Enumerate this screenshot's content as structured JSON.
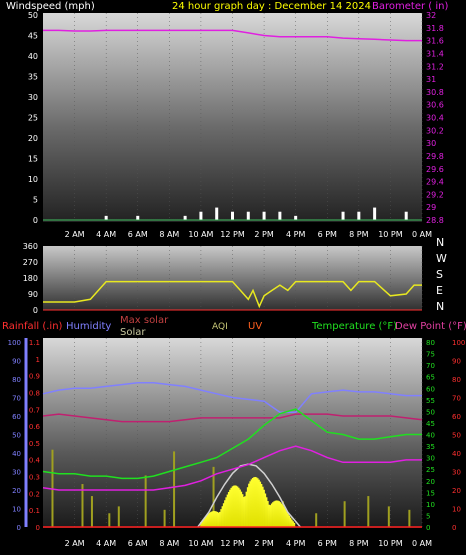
{
  "header": {
    "left_label": "Windspeed (mph)",
    "title": "24 hour graph day : December 14 2024",
    "right_label": "Barometer ( in)"
  },
  "colors": {
    "windspeed": "#ffffff",
    "barometer": "#e020e0",
    "direction": "#e8e820",
    "rainfall": "#ff3030",
    "humidity": "#8080ff",
    "solar": "#ffff00",
    "max_solar": "#c8c8c8",
    "uv": "#ff6020",
    "aqi": "#c8c878",
    "temperature": "#20e020",
    "dew_point": "#c02070",
    "temp_red": "#ff2020"
  },
  "x_ticks": [
    "2 AM",
    "4 AM",
    "6 AM",
    "8 AM",
    "10 AM",
    "12 PM",
    "2 PM",
    "4 PM",
    "6 PM",
    "8 PM",
    "10 PM",
    "0 AM"
  ],
  "panel1": {
    "left_ticks": [
      "0",
      "5",
      "10",
      "15",
      "20",
      "25",
      "30",
      "35",
      "40",
      "45",
      "50"
    ],
    "right_ticks": [
      "28.8",
      "29",
      "29.2",
      "29.4",
      "29.6",
      "29.8",
      "30",
      "30.2",
      "30.4",
      "30.6",
      "30.8",
      "31",
      "31.2",
      "31.4",
      "31.6",
      "31.8",
      "32"
    ]
  },
  "panel2": {
    "left_ticks": [
      "0",
      "90",
      "180",
      "270",
      "360"
    ],
    "compass": [
      "N",
      "W",
      "S",
      "E",
      "N"
    ]
  },
  "panel3": {
    "legend": {
      "rainfall": "Rainfall (.in)",
      "humidity": "Humidity",
      "max_solar": "Max solar",
      "solar": "Solar",
      "aqi": "AQI",
      "uv": "UV",
      "temperature": "Temperature (°F)",
      "dew_point": "Dew Point (°F)"
    },
    "left_outer_ticks": [
      "0",
      "10",
      "20",
      "30",
      "40",
      "50",
      "60",
      "70",
      "80",
      "90",
      "100"
    ],
    "left_inner_ticks": [
      "0",
      "0.1",
      "0.2",
      "0.3",
      "0.4",
      "0.5",
      "0.6",
      "0.7",
      "0.8",
      "0.9",
      "1",
      "1.1"
    ],
    "right_green_ticks": [
      "0",
      "5",
      "10",
      "15",
      "20",
      "25",
      "30",
      "35",
      "40",
      "45",
      "50",
      "55",
      "60",
      "65",
      "70",
      "75",
      "80"
    ],
    "right_red_ticks": [
      "0",
      "10",
      "20",
      "30",
      "40",
      "50",
      "60",
      "70",
      "80",
      "90",
      "100"
    ]
  },
  "chart_data": [
    {
      "type": "line",
      "title": "24 hour graph day : December 14 2024",
      "x_hours": [
        0,
        1,
        2,
        3,
        4,
        5,
        6,
        7,
        8,
        9,
        10,
        11,
        12,
        13,
        14,
        15,
        16,
        17,
        18,
        19,
        20,
        21,
        22,
        23,
        24
      ],
      "series": [
        {
          "name": "Barometer ( in)",
          "axis": "right",
          "ylim": [
            28.8,
            32.0
          ],
          "values": [
            31.76,
            31.76,
            31.75,
            31.75,
            31.76,
            31.76,
            31.76,
            31.76,
            31.76,
            31.76,
            31.76,
            31.76,
            31.76,
            31.72,
            31.68,
            31.66,
            31.66,
            31.66,
            31.66,
            31.64,
            31.63,
            31.62,
            31.61,
            31.6,
            31.6
          ]
        },
        {
          "name": "Windspeed (mph)",
          "axis": "left",
          "ylim": [
            0,
            50
          ],
          "values": [
            0,
            0,
            0,
            0,
            1,
            0,
            1,
            0,
            0,
            1,
            2,
            3,
            2,
            2,
            2,
            2,
            1,
            0,
            0,
            2,
            2,
            3,
            0,
            2,
            0
          ]
        }
      ]
    },
    {
      "type": "line",
      "ylim": [
        0,
        360
      ],
      "x_hours": [
        0,
        1,
        2,
        3,
        4,
        5,
        6,
        7,
        8,
        9,
        10,
        11,
        12,
        12.5,
        13,
        13.3,
        13.7,
        14,
        14.5,
        15,
        15.5,
        16,
        17,
        18,
        19,
        19.5,
        20,
        21,
        22,
        23,
        23.5,
        24
      ],
      "series": [
        {
          "name": "Wind direction",
          "values": [
            45,
            45,
            45,
            60,
            160,
            160,
            160,
            160,
            160,
            160,
            160,
            160,
            160,
            110,
            60,
            110,
            20,
            80,
            110,
            140,
            110,
            160,
            160,
            160,
            160,
            110,
            160,
            160,
            80,
            90,
            140,
            140
          ]
        }
      ]
    },
    {
      "type": "line",
      "x_hours": [
        0,
        1,
        2,
        3,
        4,
        5,
        6,
        7,
        8,
        9,
        10,
        11,
        12,
        13,
        14,
        15,
        16,
        17,
        18,
        19,
        20,
        21,
        22,
        23,
        24
      ],
      "series": [
        {
          "name": "Humidity",
          "axis": "left_outer",
          "ylim": [
            0,
            100
          ],
          "values": [
            72,
            74,
            75,
            75,
            76,
            77,
            78,
            78,
            77,
            76,
            74,
            72,
            70,
            69,
            68,
            62,
            62,
            72,
            73,
            74,
            73,
            73,
            72,
            71,
            71
          ]
        },
        {
          "name": "Temperature (°F)",
          "axis": "right_green",
          "ylim": [
            0,
            80
          ],
          "values": [
            24,
            23,
            23,
            22,
            22,
            21,
            21,
            22,
            24,
            26,
            28,
            30,
            34,
            38,
            44,
            49,
            51,
            46,
            41,
            40,
            38,
            38,
            39,
            40,
            40
          ]
        },
        {
          "name": "Dew Point (°F)",
          "axis": "right_red",
          "ylim": [
            0,
            100
          ],
          "values": [
            60,
            61,
            60,
            59,
            58,
            57,
            57,
            57,
            57,
            58,
            59,
            59,
            59,
            59,
            59,
            59,
            61,
            61,
            61,
            60,
            60,
            60,
            60,
            59,
            58
          ]
        },
        {
          "name": "Magenta trace",
          "axis": "right_green",
          "ylim": [
            0,
            80
          ],
          "values": [
            17,
            16,
            16,
            16,
            16,
            16,
            16,
            16,
            17,
            18,
            20,
            23,
            25,
            27,
            30,
            33,
            35,
            33,
            30,
            28,
            28,
            28,
            28,
            29,
            29
          ]
        },
        {
          "name": "Max solar",
          "axis": "right_red",
          "ylim": [
            0,
            100
          ],
          "values": [
            0,
            0,
            0,
            0,
            0,
            0,
            0,
            0,
            0,
            0,
            0,
            0,
            0,
            0,
            0,
            0,
            0,
            0,
            0,
            0,
            0,
            0,
            0,
            0,
            0
          ]
        },
        {
          "name": "Solar",
          "axis": "right_red",
          "ylim": [
            0,
            100
          ],
          "values": [
            0,
            0,
            0,
            0,
            0,
            0,
            0,
            0,
            0,
            0,
            3,
            12,
            22,
            30,
            24,
            14,
            3,
            0,
            0,
            0,
            0,
            0,
            0,
            0,
            0
          ]
        }
      ],
      "max_solar_curve": {
        "x_hours": [
          9.8,
          10.5,
          11,
          11.5,
          12,
          12.5,
          13,
          13.5,
          14,
          14.5,
          15,
          15.5,
          16.3
        ],
        "values": [
          0,
          8,
          16,
          23,
          29,
          33,
          34,
          33,
          29,
          23,
          16,
          8,
          0
        ]
      },
      "rain_bars": {
        "x_hours": [
          0.6,
          2.5,
          3.1,
          4.2,
          4.8,
          6.5,
          7.7,
          8.3,
          10.4,
          10.8,
          12.1,
          12.6,
          13.4,
          15.2,
          17.3,
          19.1,
          20.6,
          21.9,
          23.2
        ],
        "values": [
          0.45,
          0.25,
          0.18,
          0.08,
          0.12,
          0.3,
          0.1,
          0.44,
          0.05,
          0.35,
          0.1,
          0.06,
          0.05,
          0.15,
          0.08,
          0.15,
          0.18,
          0.12,
          0.1
        ]
      }
    }
  ]
}
